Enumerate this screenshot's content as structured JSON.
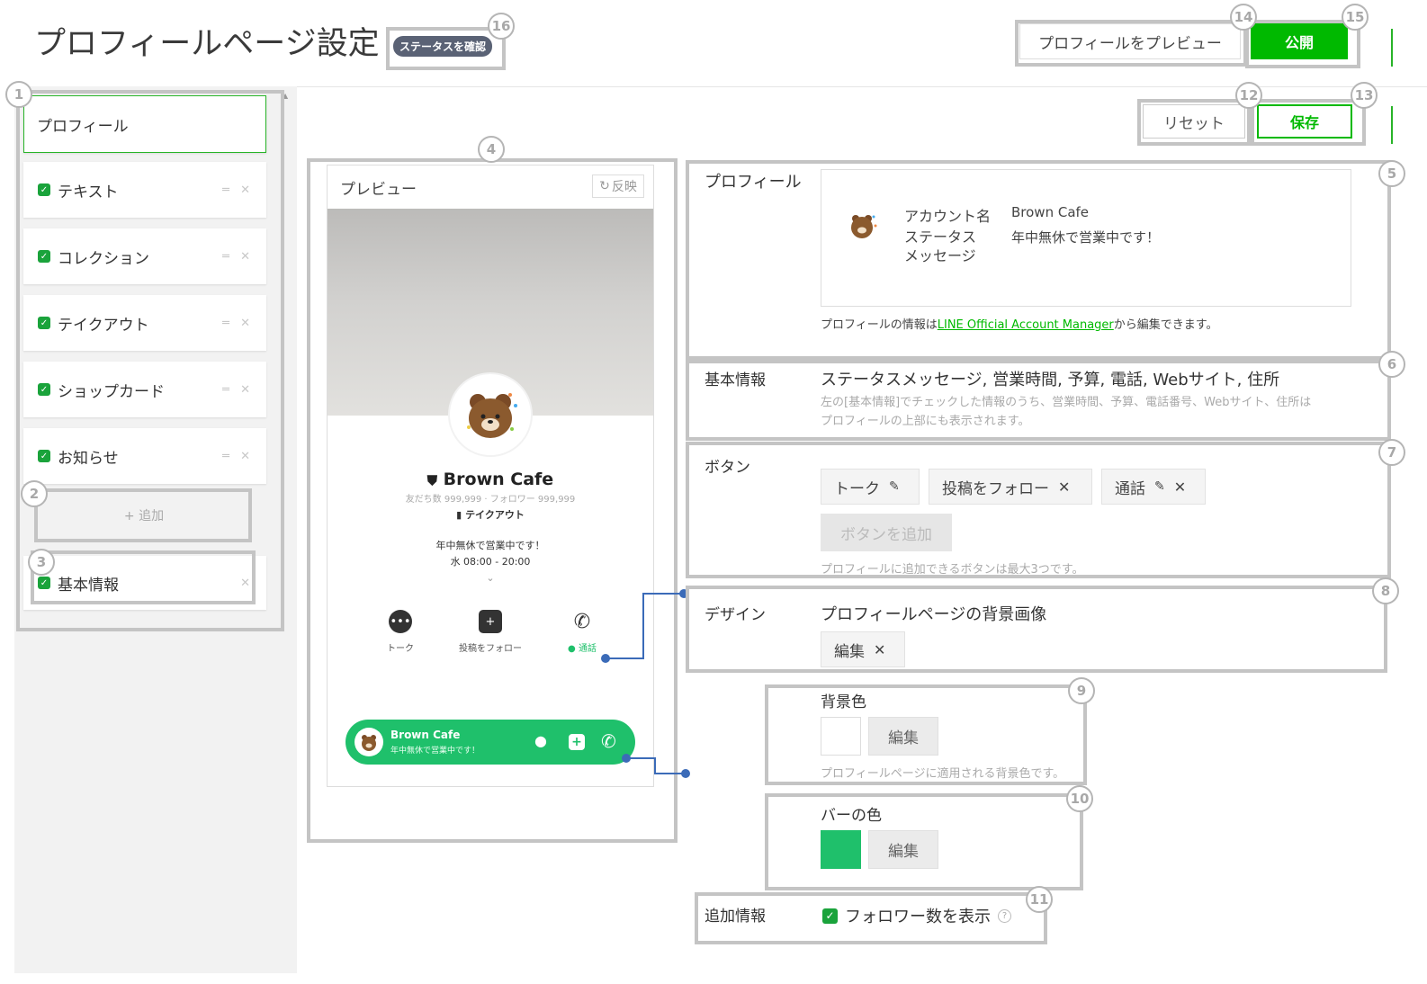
{
  "header": {
    "title": "プロフィールページ設定",
    "status_badge": "ステータスを確認",
    "preview_button": "プロフィールをプレビュー",
    "publish_button": "公開",
    "reset_button": "リセット",
    "save_button": "保存"
  },
  "sidebar": {
    "profile": "プロフィール",
    "items": [
      {
        "label": "テキスト"
      },
      {
        "label": "コレクション"
      },
      {
        "label": "テイクアウト"
      },
      {
        "label": "ショップカード"
      },
      {
        "label": "お知らせ"
      }
    ],
    "add_button": "+ 追加",
    "basic_info": "基本情報"
  },
  "preview": {
    "title": "プレビュー",
    "reflect_button": "反映",
    "account_name": "Brown Cafe",
    "stats": "友だち数 999,999 · フォロワー 999,999",
    "takeout": "テイクアウト",
    "status_message": "年中無休で営業中です！",
    "hours": "水 08:00 - 20:00",
    "actions": [
      "トーク",
      "投稿をフォロー",
      "通話"
    ],
    "bar_name": "Brown Cafe",
    "bar_message": "年中無休で営業中です！"
  },
  "profile_section": {
    "label": "プロフィール",
    "account_name_label": "アカウント名",
    "account_name_value": "Brown Cafe",
    "status_label_1": "ステータス",
    "status_label_2": "メッセージ",
    "status_value": "年中無休で営業中です！",
    "note_prefix": "プロフィールの情報は",
    "note_link": "LINE Official Account Manager",
    "note_suffix": "から編集できます。"
  },
  "basic_info_section": {
    "label": "基本情報",
    "value": "ステータスメッセージ, 営業時間, 予算, 電話, Webサイト, 住所",
    "note_1": "左の[基本情報]でチェックした情報のうち、営業時間、予算、電話番号、Webサイト、住所は",
    "note_2": "プロフィールの上部にも表示されます。"
  },
  "button_section": {
    "label": "ボタン",
    "chips": [
      "トーク",
      "投稿をフォロー",
      "通話"
    ],
    "add_button": "ボタンを追加",
    "note": "プロフィールに追加できるボタンは最大3つです。"
  },
  "design_section": {
    "label": "デザイン",
    "bg_image_title": "プロフィールページの背景画像",
    "bg_image_edit": "編集",
    "bg_color_title": "背景色",
    "bg_color_edit": "編集",
    "bg_color_note": "プロフィールページに適用される背景色です。",
    "bar_color_title": "バーの色",
    "bar_color_edit": "編集"
  },
  "additional_section": {
    "label": "追加情報",
    "show_followers": "フォロワー数を表示"
  },
  "colors": {
    "accent": "#00b900",
    "bar": "#1fc06b",
    "badge": "#5a6275"
  },
  "callouts": [
    "1",
    "2",
    "3",
    "4",
    "5",
    "6",
    "7",
    "8",
    "9",
    "10",
    "11",
    "12",
    "13",
    "14",
    "15",
    "16"
  ]
}
